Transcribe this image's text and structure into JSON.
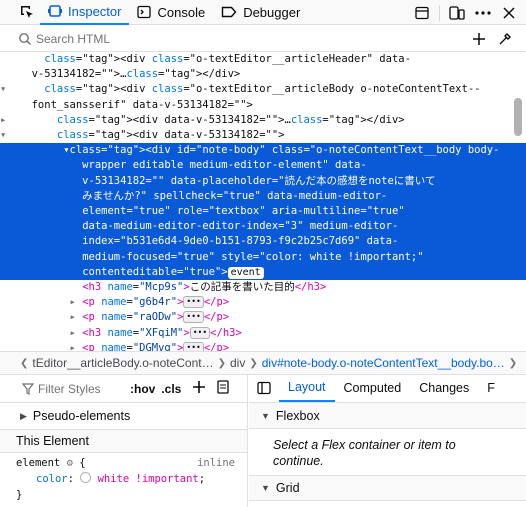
{
  "toolbar": {
    "tabs": [
      {
        "label": "Inspector",
        "icon": "inspector-icon"
      },
      {
        "label": "Console",
        "icon": "console-icon"
      },
      {
        "label": "Debugger",
        "icon": "debugger-icon"
      }
    ],
    "right_icons": [
      "dock-icon",
      "responsive-icon",
      "more-icon",
      "close-icon"
    ]
  },
  "search": {
    "placeholder": "Search HTML"
  },
  "markup": {
    "lines": [
      {
        "indent": "      ",
        "arrow": "",
        "html": "<div class=\"o-textEditor__articleHeader\" data-"
      },
      {
        "indent": "    ",
        "arrow": "",
        "html": "v-53134182=\"\">…</div>"
      },
      {
        "indent": "      ",
        "arrow": "▾",
        "html": "<div class=\"o-textEditor__articleBody o-noteContentText--"
      },
      {
        "indent": "    ",
        "arrow": "",
        "html": "font_sansserif\" data-v-53134182=\"\">"
      },
      {
        "indent": "        ",
        "arrow": "▸",
        "html": "<div data-v-53134182=\"\">…</div>"
      },
      {
        "indent": "        ",
        "arrow": "▾",
        "html": "<div data-v-53134182=\"\">"
      }
    ],
    "selected_lines": [
      "<div id=\"note-body\" class=\"o-noteContentText__body body-",
      "wrapper editable medium-editor-element\" data-",
      "v-53134182=\"\" data-placeholder=\"読んだ本の感想をnoteに書いて",
      "みませんか?\" spellcheck=\"true\" data-medium-editor-",
      "element=\"true\" role=\"textbox\" aria-multiline=\"true\"",
      "data-medium-editor-editor-index=\"3\" medium-editor-",
      "index=\"b531e6d4-9de0-b151-8793-f9c2b25c7d69\" data-",
      "medium-focused=\"true\" style=\"color: white !important;\"",
      "contenteditable=\"true\">"
    ],
    "event_badge": "event",
    "children": [
      {
        "arrow": "",
        "tag": "h3",
        "name": "Mcp9s",
        "content": "この記事を書いた目的"
      },
      {
        "arrow": "▸",
        "tag": "p",
        "name": "g6b4r",
        "content": "…"
      },
      {
        "arrow": "▸",
        "tag": "p",
        "name": "raODw",
        "content": "…"
      },
      {
        "arrow": "▸",
        "tag": "h3",
        "name": "XFqiM",
        "content": "…"
      },
      {
        "arrow": "▸",
        "tag": "p",
        "name": "DGMvg",
        "content": "…"
      }
    ]
  },
  "breadcrumbs": {
    "items": [
      "tEditor__articleBody.o-noteCont…",
      "div",
      "div#note-body.o-noteContentText__body.bo…"
    ]
  },
  "rules": {
    "filter_placeholder": "Filter Styles",
    "hov": ":hov",
    "cls": ".cls",
    "pseudo_label": "Pseudo-elements",
    "this_element": "This Element",
    "selector": "element",
    "brace_open": "{",
    "brace_close": "}",
    "inline": "inline",
    "prop": "color",
    "value": "white !important"
  },
  "layout": {
    "tabs": [
      "Layout",
      "Computed",
      "Changes",
      "F"
    ],
    "flexbox_label": "Flexbox",
    "flex_text": "Select a Flex container or item to continue.",
    "grid_label": "Grid"
  }
}
